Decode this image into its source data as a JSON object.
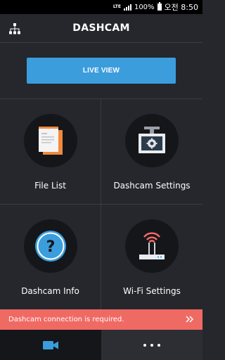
{
  "status_bar": {
    "network": "LTE",
    "battery": "100%",
    "time": "오전 8:50"
  },
  "header": {
    "title": "DASHCAM",
    "menu_icon": "sitemap-icon"
  },
  "live_view": {
    "label": "LIVE VIEW"
  },
  "menu": {
    "items": [
      {
        "label": "File List",
        "icon": "file-list-icon"
      },
      {
        "label": "Dashcam Settings",
        "icon": "dashcam-settings-icon"
      },
      {
        "label": "Dashcam Info",
        "icon": "question-icon"
      },
      {
        "label": "Wi-Fi Settings",
        "icon": "wifi-router-icon"
      }
    ]
  },
  "notice": {
    "text": "Dashcam connection is required.",
    "icon": "double-chevron-right-icon"
  },
  "tabs": [
    {
      "icon": "video-camera-icon",
      "active": true
    },
    {
      "icon": "more-dots-icon",
      "active": false
    }
  ],
  "colors": {
    "background": "#25272c",
    "accent": "#3b9ddc",
    "notice": "#f06a64",
    "orange": "#f08a3c"
  }
}
